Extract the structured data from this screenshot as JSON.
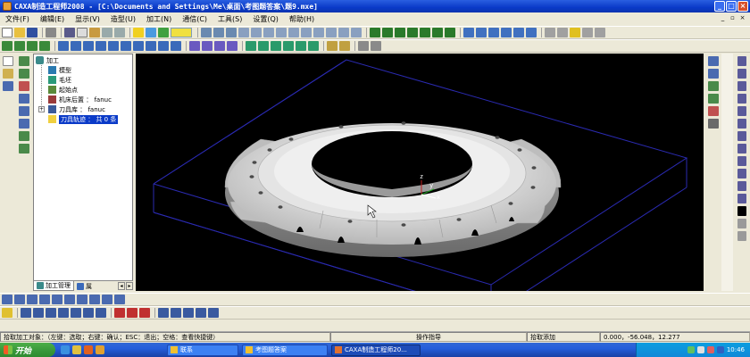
{
  "window": {
    "title": "CAXA制造工程师2008 - [C:\\Documents and Settings\\Me\\桌面\\考图题答案\\题9.mxe]"
  },
  "menu": {
    "items": [
      "文件(F)",
      "编辑(E)",
      "显示(V)",
      "造型(U)",
      "加工(N)",
      "通信(C)",
      "工具(S)",
      "设置(Q)",
      "帮助(H)"
    ]
  },
  "tree": {
    "root": "加工",
    "items": [
      {
        "label": "模型",
        "icon": "model-icon"
      },
      {
        "label": "毛坯",
        "icon": "stock-icon"
      },
      {
        "label": "起始点",
        "icon": "start-point-icon"
      },
      {
        "label": "机床后置 ： fanuc",
        "icon": "machine-post-icon"
      },
      {
        "label": "刀具库 ： fanuc",
        "icon": "tool-library-icon"
      },
      {
        "label": "刀具轨迹 ： 共 0 条",
        "icon": "toolpath-folder-icon"
      }
    ],
    "tabs": [
      "加工管理",
      "属"
    ]
  },
  "viewport": {
    "axis_labels": {
      "z": "z",
      "y": "y",
      "x": "x"
    }
  },
  "status": {
    "prompt": "拾取加工对象：（左键：选取；右键：确认；ESC：退出；空格：查看快捷键）",
    "mode": "操作指导",
    "action": "拾取添加",
    "coords": "0.000，-56.048，12.277"
  },
  "taskbar": {
    "start": "开始",
    "tasks": [
      "联系",
      "考图题答案",
      "CAXA制造工程师20..."
    ],
    "clock": "10:46"
  }
}
